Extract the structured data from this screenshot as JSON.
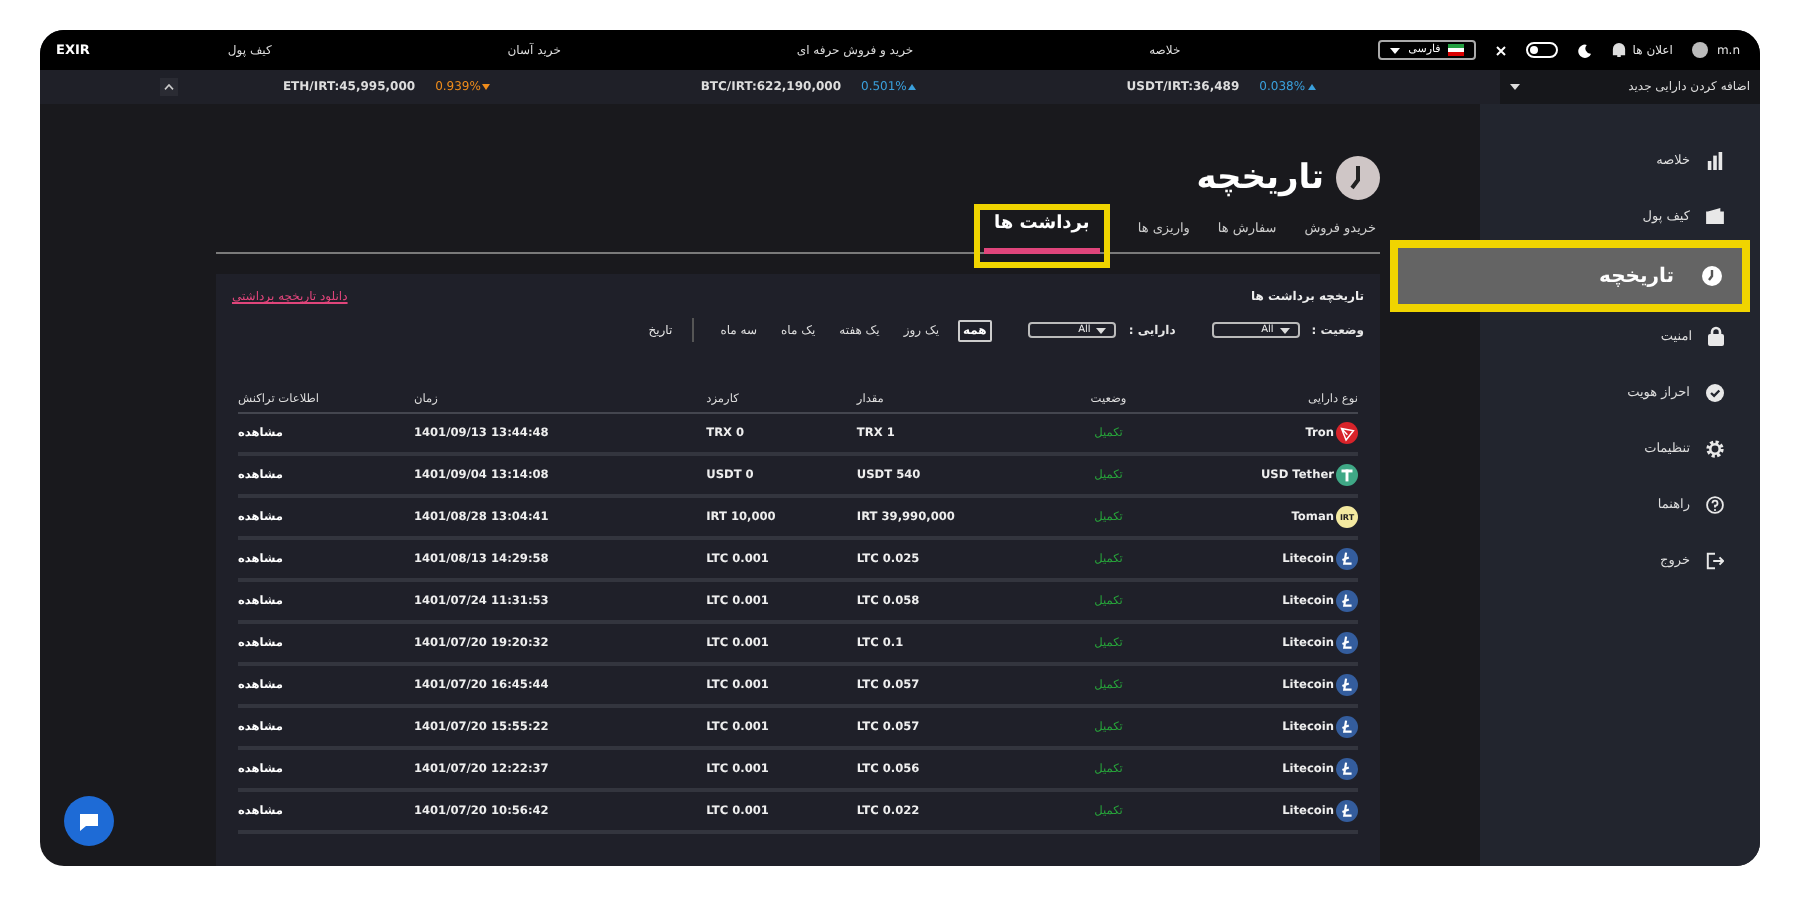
{
  "top_bar": {
    "logo": "EXIR",
    "nav": [
      "خلاصه",
      "خرید و فروش حرفه ای",
      "خرید آسان",
      "کیف پول"
    ],
    "language": "فارسی",
    "theme_switch": {
      "on": false
    },
    "notifications": "اعلان ها",
    "user": "m.n"
  },
  "ticker_bar": {
    "add_asset": "اضافه کردن دارایی جدید",
    "tickers": [
      {
        "quote": "USDT/IRT:36,489",
        "change": "0.038%",
        "kind": "up"
      },
      {
        "quote": "BTC/IRT:622,190,000",
        "change": "0.501%",
        "kind": "up"
      },
      {
        "quote": "ETH/IRT:45,995,000",
        "change": "0.939%",
        "kind": "down"
      }
    ]
  },
  "sidebar": {
    "items": [
      {
        "label": "خلاصه",
        "kind": "summary",
        "selected": false
      },
      {
        "label": "کیف پول",
        "kind": "wallet",
        "selected": false
      },
      {
        "label": "تاریخچه",
        "kind": "history",
        "selected": true
      },
      {
        "label": "امنیت",
        "kind": "security",
        "selected": false
      },
      {
        "label": "احراز هویت",
        "kind": "identity",
        "selected": false
      },
      {
        "label": "تنظیمات",
        "kind": "settings",
        "selected": false
      },
      {
        "label": "راهنما",
        "kind": "help",
        "selected": false
      },
      {
        "label": "خروج",
        "kind": "logout",
        "selected": false
      }
    ]
  },
  "page": {
    "title": "تاریخچه",
    "tabs": [
      {
        "label": "خریدو فروش",
        "selected": false
      },
      {
        "label": "سفارش ها",
        "selected": false
      },
      {
        "label": "واریزی ها",
        "selected": false
      },
      {
        "label": "برداشت ها",
        "selected": true
      }
    ]
  },
  "panel": {
    "title": "تاریخچه برداشت ها",
    "download_link": "دانلود تاریخچه برداشتی",
    "filters": {
      "status_label": "وضعیت :",
      "status_value": "All",
      "asset_label": "دارایی :",
      "asset_value": "All",
      "periods": [
        {
          "label": "همه",
          "selected": true
        },
        {
          "label": "یک روز",
          "selected": false
        },
        {
          "label": "یک هفته",
          "selected": false
        },
        {
          "label": "یک ماه",
          "selected": false
        },
        {
          "label": "سه ماه",
          "selected": false
        }
      ],
      "date_label": "تاریخ"
    },
    "table": {
      "columns": [
        "نوع دارایی",
        "وضعیت",
        "مقدار",
        "کارمزد",
        "زمان",
        "اطلاعات تراکنش"
      ],
      "rows": [
        {
          "kind": "tron",
          "asset": "Tron",
          "status": "تکمیل",
          "amount": "TRX 1",
          "fee": "TRX 0",
          "time": "13:44:48 1401/09/13",
          "action": "مشاهده"
        },
        {
          "kind": "tether",
          "asset": "USD Tether",
          "status": "تکمیل",
          "amount": "USDT 540",
          "fee": "USDT 0",
          "time": "13:14:08 1401/09/04",
          "action": "مشاهده"
        },
        {
          "kind": "irt",
          "coin_text": "IRT",
          "asset": "Toman",
          "status": "تکمیل",
          "amount": "IRT 39,990,000",
          "fee": "IRT 10,000",
          "time": "13:04:41 1401/08/28",
          "action": "مشاهده"
        },
        {
          "kind": "litecoin",
          "asset": "Litecoin",
          "status": "تکمیل",
          "amount": "LTC 0.025",
          "fee": "LTC 0.001",
          "time": "14:29:58 1401/08/13",
          "action": "مشاهده"
        },
        {
          "kind": "litecoin",
          "asset": "Litecoin",
          "status": "تکمیل",
          "amount": "LTC 0.058",
          "fee": "LTC 0.001",
          "time": "11:31:53 1401/07/24",
          "action": "مشاهده"
        },
        {
          "kind": "litecoin",
          "asset": "Litecoin",
          "status": "تکمیل",
          "amount": "LTC 0.1",
          "fee": "LTC 0.001",
          "time": "19:20:32 1401/07/20",
          "action": "مشاهده"
        },
        {
          "kind": "litecoin",
          "asset": "Litecoin",
          "status": "تکمیل",
          "amount": "LTC 0.057",
          "fee": "LTC 0.001",
          "time": "16:45:44 1401/07/20",
          "action": "مشاهده"
        },
        {
          "kind": "litecoin",
          "asset": "Litecoin",
          "status": "تکمیل",
          "amount": "LTC 0.057",
          "fee": "LTC 0.001",
          "time": "15:55:22 1401/07/20",
          "action": "مشاهده"
        },
        {
          "kind": "litecoin",
          "asset": "Litecoin",
          "status": "تکمیل",
          "amount": "LTC 0.056",
          "fee": "LTC 0.001",
          "time": "12:22:37 1401/07/20",
          "action": "مشاهده"
        },
        {
          "kind": "litecoin",
          "asset": "Litecoin",
          "status": "تکمیل",
          "amount": "LTC 0.022",
          "fee": "LTC 0.001",
          "time": "10:56:42 1401/07/20",
          "action": "مشاهده"
        }
      ]
    }
  }
}
